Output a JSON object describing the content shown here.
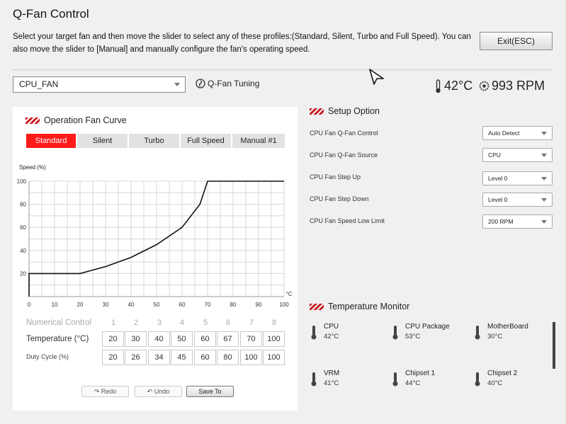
{
  "window": {
    "title": "Q-Fan Control",
    "description": "Select your target fan and then move the slider to select any of these profiles:(Standard, Silent, Turbo and Full Speed). You can also move the slider to [Manual] and manually configure the fan's operating speed.",
    "exit_label": "Exit(ESC)"
  },
  "fan_selector": {
    "value": "CPU_FAN"
  },
  "qfan_tuning_label": "Q-Fan Tuning",
  "readouts": {
    "temperature": "42°C",
    "rpm": "993 RPM"
  },
  "curve_panel": {
    "title": "Operation Fan Curve",
    "tabs": [
      {
        "label": "Standard",
        "active": true
      },
      {
        "label": "Silent",
        "active": false
      },
      {
        "label": "Turbo",
        "active": false
      },
      {
        "label": "Full Speed",
        "active": false
      },
      {
        "label": "Manual #1",
        "active": false
      }
    ],
    "numerical_control_label": "Numerical Control",
    "point_numbers": [
      "1",
      "2",
      "3",
      "4",
      "5",
      "6",
      "7",
      "8"
    ],
    "temperature_label": "Temperature (°C)",
    "duty_cycle_label": "Duty Cycle (%)",
    "temperatures": [
      "20",
      "30",
      "40",
      "50",
      "60",
      "67",
      "70",
      "100"
    ],
    "duty_cycles": [
      "20",
      "26",
      "34",
      "45",
      "60",
      "80",
      "100",
      "100"
    ],
    "buttons": {
      "redo": "Redo",
      "undo": "Undo",
      "save": "Save To"
    }
  },
  "chart_data": {
    "type": "line",
    "ylabel": "Speed (%)",
    "xlabel": "°C",
    "xlim": [
      0,
      100
    ],
    "ylim": [
      0,
      100
    ],
    "x_ticks": [
      0,
      10,
      20,
      30,
      40,
      50,
      60,
      70,
      80,
      90,
      100
    ],
    "y_ticks": [
      20,
      40,
      60,
      80,
      100
    ],
    "grid": true,
    "series": [
      {
        "x": [
          0,
          0,
          20,
          30,
          40,
          50,
          60,
          67,
          70,
          100
        ],
        "y": [
          0,
          20,
          20,
          26,
          34,
          45,
          60,
          80,
          100,
          100
        ]
      }
    ]
  },
  "setup": {
    "title": "Setup Option",
    "options": [
      {
        "label": "CPU Fan Q-Fan Control",
        "value": "Auto Detect"
      },
      {
        "label": "CPU Fan Q-Fan Source",
        "value": "CPU"
      },
      {
        "label": "CPU Fan Step Up",
        "value": "Level 0"
      },
      {
        "label": "CPU Fan Step Down",
        "value": "Level 0"
      },
      {
        "label": "CPU Fan Speed Low Limit",
        "value": "200 RPM"
      }
    ]
  },
  "monitor": {
    "title": "Temperature Monitor",
    "items": [
      {
        "name": "CPU",
        "value": "42°C"
      },
      {
        "name": "CPU Package",
        "value": "53°C"
      },
      {
        "name": "MotherBoard",
        "value": "30°C"
      },
      {
        "name": "VRM",
        "value": "41°C"
      },
      {
        "name": "Chipset 1",
        "value": "44°C"
      },
      {
        "name": "Chipset 2",
        "value": "40°C"
      }
    ]
  },
  "colors": {
    "accent": "#ff1a1a",
    "stripe": "#c8181e"
  }
}
